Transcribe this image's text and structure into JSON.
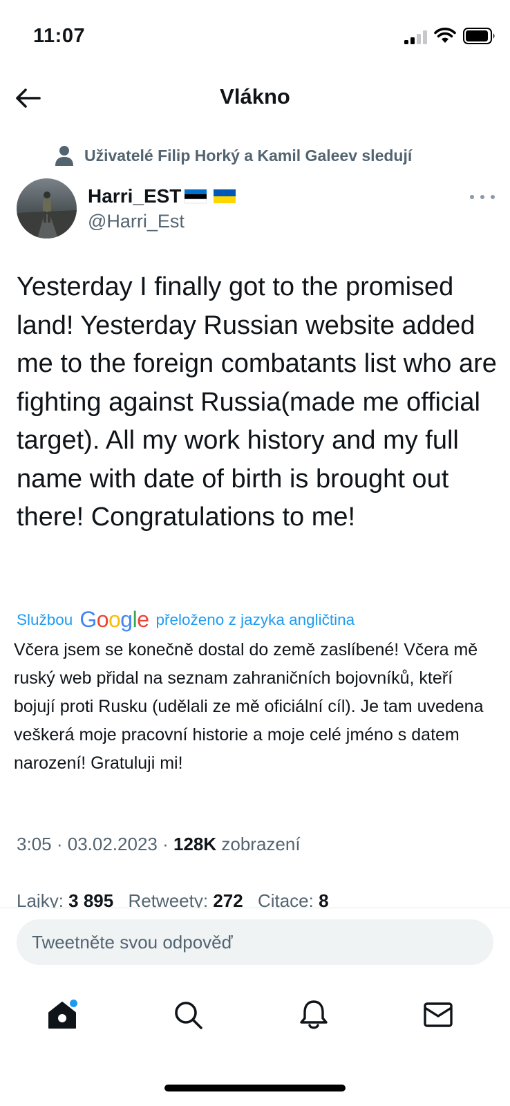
{
  "status_bar": {
    "time": "11:07"
  },
  "header": {
    "title": "Vlákno"
  },
  "social_context": {
    "text": "Uživatelé Filip Horký a Kamil Galeev sledují"
  },
  "author": {
    "name": "Harri_EST",
    "handle": "@Harri_Est",
    "flags": [
      "estonia-flag",
      "ukraine-flag"
    ]
  },
  "tweet": {
    "text": "Yesterday I finally got to the promised land! Yesterday Russian website added me to the foreign combatants list who are fighting against Russia(made me official target). All my work history and my full name with date of birth is brought out there! Congratulations to me!",
    "translated_prefix": "Službou",
    "translated_brand": "Google",
    "translated_suffix": "přeloženo z jazyka angličtina",
    "translation": "Včera jsem se konečně dostal do země zaslíbené! Včera mě ruský web přidal na seznam zahraničních bojovníků, kteří bojují proti Rusku (udělali ze mě oficiální cíl). Je tam uvedena veškerá moje pracovní historie a moje celé jméno s datem narození! Gratuluji mi!",
    "time": "3:05",
    "date": "03.02.2023",
    "views_count": "128K",
    "views_label": "zobrazení"
  },
  "stats": {
    "likes_label": "Lajky:",
    "likes_value": "3 895",
    "retweets_label": "Retweety:",
    "retweets_value": "272",
    "quotes_label": "Citace:",
    "quotes_value": "8"
  },
  "reply": {
    "placeholder": "Tweetněte svou odpověď"
  },
  "bottom_nav": {
    "items": [
      "home-icon",
      "search-icon",
      "notifications-icon",
      "messages-icon"
    ]
  },
  "colors": {
    "accent": "#1d9bf0",
    "text": "#0f1419",
    "secondary": "#536471",
    "reply_bg": "#eff3f4"
  }
}
